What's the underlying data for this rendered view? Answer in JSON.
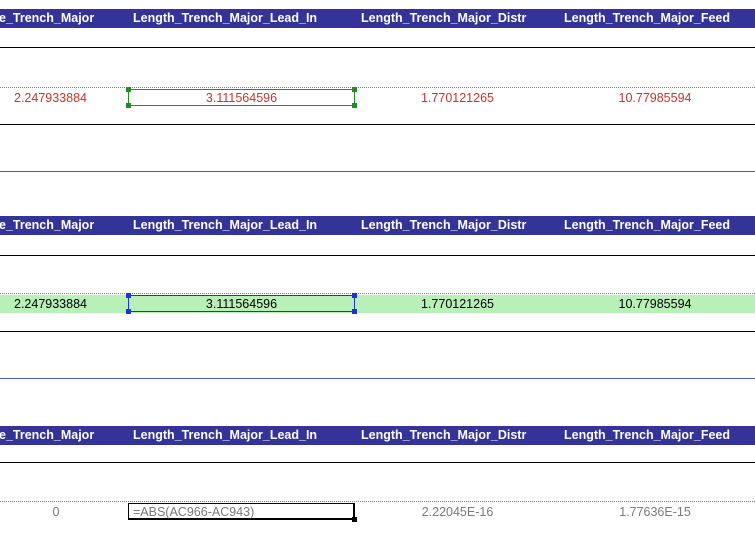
{
  "headers": [
    "e_Trench_Major",
    "Length_Trench_Major_Lead_In",
    "Length_Trench_Major_Distr",
    "Length_Trench_Major_Feed"
  ],
  "blocks": [
    {
      "values": [
        "2.247933884",
        "3.111564596",
        "1.770121265",
        "10.77985594"
      ],
      "text_color": "#c0392b",
      "row_fill": "none",
      "selection_color": "#228b22"
    },
    {
      "values": [
        "2.247933884",
        "3.111564596",
        "1.770121265",
        "10.77985594"
      ],
      "text_color": "#000000",
      "row_fill": "#b8f0b8",
      "selection_color": "#2233cc"
    },
    {
      "values": [
        "0",
        "=ABS(AC966-AC943)",
        "2.22045E-16",
        "1.77636E-15"
      ],
      "text_color": "#7a7a7a",
      "row_fill": "none",
      "selection_color": "#000000"
    }
  ],
  "colors": {
    "header_bg": "#333399",
    "header_text": "#ffffff",
    "separator": "#4a5bc4"
  }
}
